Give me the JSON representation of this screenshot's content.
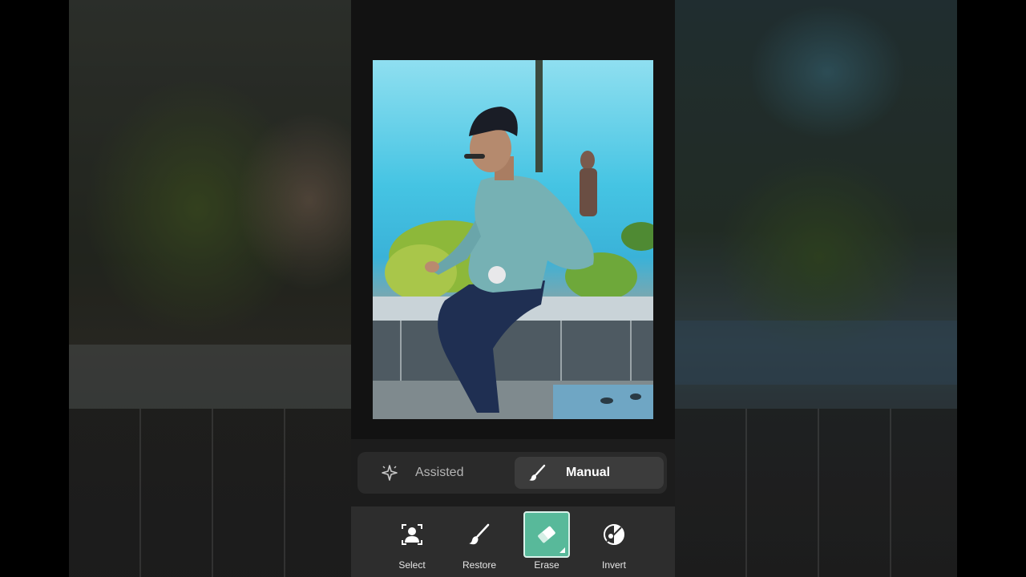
{
  "mode_selector": {
    "assisted_label": "Assisted",
    "manual_label": "Manual",
    "selected": "Manual"
  },
  "toolbar": {
    "tools": [
      {
        "label": "Select",
        "icon": "person-select-icon"
      },
      {
        "label": "Restore",
        "icon": "brush-icon"
      },
      {
        "label": "Erase",
        "icon": "eraser-icon"
      },
      {
        "label": "Invert",
        "icon": "invert-icon"
      }
    ],
    "active": "Erase"
  },
  "colors": {
    "accent": "#58b99a",
    "panel": "#2d2d2d",
    "background": "#121212"
  },
  "photo": {
    "subject": "man sitting on ledge in teal sweater"
  }
}
